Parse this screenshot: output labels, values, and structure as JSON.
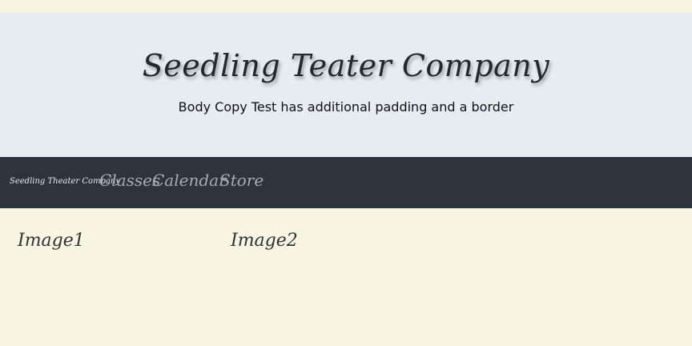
{
  "header": {
    "title": "Seedling Teater Company",
    "tagline": "Body Copy Test has additional padding and a border"
  },
  "navbar": {
    "brand": "Seedling Theater Company",
    "links": [
      {
        "label": "Classes"
      },
      {
        "label": "Calendar"
      },
      {
        "label": "Store"
      }
    ]
  },
  "main": {
    "images": [
      {
        "label": "Image1"
      },
      {
        "label": "Image2"
      }
    ]
  },
  "colors": {
    "page_background": "#f7f4e1",
    "header_background": "#e6ecf1",
    "navbar_background": "#2d343b",
    "nav_link": "#a7adb2"
  }
}
